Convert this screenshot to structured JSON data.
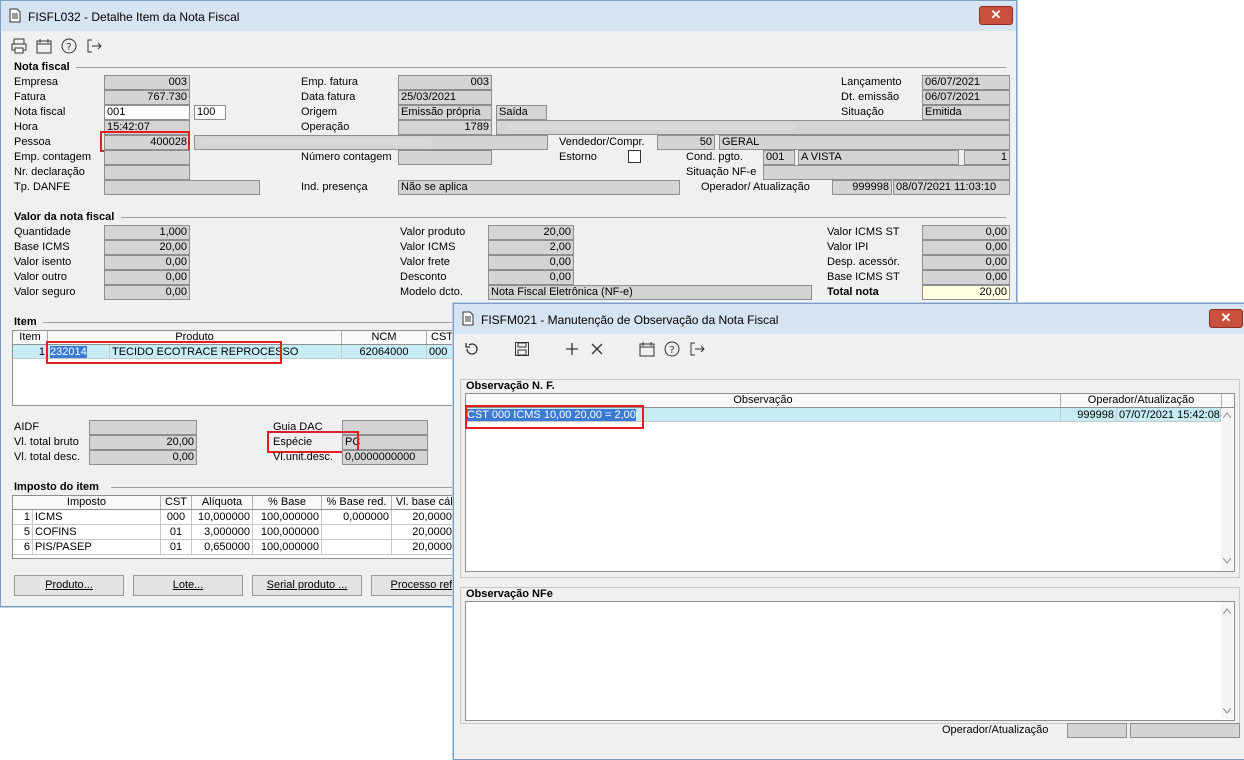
{
  "main_window": {
    "title": "FISFL032 - Detalhe Item da Nota Fiscal",
    "close": "✕",
    "nota_fiscal": {
      "section": "Nota fiscal",
      "empresa_label": "Empresa",
      "empresa": "003",
      "fatura_label": "Fatura",
      "fatura": "767.730",
      "nota_label": "Nota fiscal",
      "nota": "001",
      "nota_serie": "100",
      "hora_label": "Hora",
      "hora": "15:42:07",
      "pessoa_label": "Pessoa",
      "pessoa": "400028",
      "emp_contagem_label": "Emp. contagem",
      "nr_declaracao_label": "Nr. declaração",
      "tp_danfe_label": "Tp. DANFE",
      "emp_fatura_label": "Emp. fatura",
      "emp_fatura": "003",
      "data_fatura_label": "Data fatura",
      "data_fatura": "25/03/2021",
      "origem_label": "Origem",
      "origem": "Emissão própria",
      "origem_tipo": "Saída",
      "operacao_label": "Operação",
      "operacao": "1789",
      "numero_contagem_label": "Número contagem",
      "ind_presenca_label": "Ind. presença",
      "ind_presenca": "Não se aplica",
      "vendedor_label": "Vendedor/Compr.",
      "vendedor_cod": "50",
      "vendedor_nome": "GERAL",
      "estorno_label": "Estorno",
      "cond_pgto_label": "Cond. pgto.",
      "cond_pgto_cod": "001",
      "cond_pgto": "A VISTA",
      "cond_pgto_n": "1",
      "situacao_nfe_label": "Situação NF-e",
      "operador_label": "Operador/ Atualização",
      "operador": "999998",
      "operador_data": "08/07/2021 11:03:10",
      "lancamento_label": "Lançamento",
      "lancamento": "06/07/2021",
      "dt_emissao_label": "Dt. emissão",
      "dt_emissao": "06/07/2021",
      "situacao_label": "Situação",
      "situacao": "Emitida"
    },
    "valor": {
      "section": "Valor da nota fiscal",
      "quantidade_label": "Quantidade",
      "quantidade": "1,000",
      "base_icms_label": "Base ICMS",
      "base_icms": "20,00",
      "valor_isento_label": "Valor isento",
      "valor_isento": "0,00",
      "valor_outro_label": "Valor outro",
      "valor_outro": "0,00",
      "valor_seguro_label": "Valor seguro",
      "valor_seguro": "0,00",
      "valor_produto_label": "Valor produto",
      "valor_produto": "20,00",
      "valor_icms_label": "Valor ICMS",
      "valor_icms": "2,00",
      "valor_frete_label": "Valor frete",
      "valor_frete": "0,00",
      "desconto_label": "Desconto",
      "desconto": "0,00",
      "modelo_label": "Modelo dcto.",
      "modelo": "Nota Fiscal Eletrônica (NF-e)",
      "valor_icms_st_label": "Valor ICMS ST",
      "valor_icms_st": "0,00",
      "valor_ipi_label": "Valor IPI",
      "valor_ipi": "0,00",
      "desp_label": "Desp. acessór.",
      "desp": "0,00",
      "base_icms_st_label": "Base ICMS ST",
      "base_icms_st": "0,00",
      "total_label": "Total nota",
      "total": "20,00"
    },
    "item": {
      "section": "Item",
      "headers": [
        "Item",
        "Produto",
        "NCM",
        "CST"
      ],
      "row": {
        "item": "1",
        "codigo": "232014",
        "produto": "TECIDO ECOTRACE REPROCESSO",
        "ncm": "62064000",
        "cst": "000"
      }
    },
    "detalhe": {
      "aidf_label": "AIDF",
      "vl_bruto_label": "Vl. total bruto",
      "vl_bruto": "20,00",
      "vl_desc_label": "Vl. total desc.",
      "vl_desc": "0,00",
      "guia_label": "Guia DAC",
      "especie_label": "Espécie",
      "especie": "PC",
      "vl_unit_desc_label": "Vl.unit.desc.",
      "vl_unit_desc": "0,0000000000"
    },
    "imposto": {
      "section": "Imposto do item",
      "headers": [
        "Imposto",
        "CST",
        "Alíquota",
        "% Base",
        "% Base red.",
        "Vl. base cálc"
      ],
      "rows": [
        {
          "n": "1",
          "nome": "ICMS",
          "cst": "000",
          "aliq": "10,000000",
          "base": "100,000000",
          "red": "0,000000",
          "vl": "20,0000"
        },
        {
          "n": "5",
          "nome": "COFINS",
          "cst": "01",
          "aliq": "3,000000",
          "base": "100,000000",
          "red": "",
          "vl": "20,0000"
        },
        {
          "n": "6",
          "nome": "PIS/PASEP",
          "cst": "01",
          "aliq": "0,650000",
          "base": "100,000000",
          "red": "",
          "vl": "20,0000"
        }
      ]
    },
    "buttons": {
      "produto": "Produto...",
      "lote": "Lote...",
      "serial": "Serial produto ...",
      "processo": "Processo ref..."
    }
  },
  "obs_window": {
    "title": "FISFM021 - Manutenção de Observação da Nota Fiscal",
    "close": "✕",
    "obs_section": "Observação N. F.",
    "headers": [
      "Observação",
      "Operador/Atualização"
    ],
    "row": {
      "obs": "CST 000 ICMS 10,00 20,00 = 2,00",
      "operador": "999998",
      "data": "07/07/2021 15:42:08"
    },
    "nfe_section": "Observação NFe",
    "operador_label": "Operador/Atualização"
  }
}
